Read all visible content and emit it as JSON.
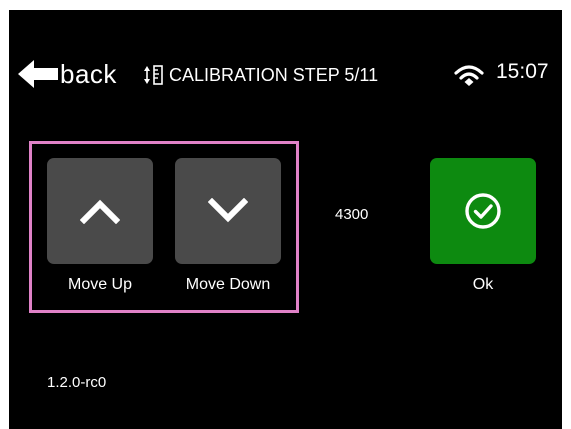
{
  "header": {
    "back_label": "back",
    "step_title": "CALIBRATION STEP 5/11",
    "time": "15:07"
  },
  "controls": {
    "move_up_label": "Move Up",
    "move_down_label": "Move Down",
    "ok_label": "Ok"
  },
  "readout": {
    "value": "4300"
  },
  "footer": {
    "version": "1.2.0-rc0"
  },
  "colors": {
    "background": "#000000",
    "tile_grey": "#4a4a4a",
    "ok_green": "#0d8a10",
    "selection_border": "#e082c8"
  },
  "icons": {
    "back": "left-arrow-icon",
    "step": "vertical-calibration-icon",
    "wifi": "wifi-icon",
    "up": "chevron-up-icon",
    "down": "chevron-down-icon",
    "ok": "check-circle-icon"
  }
}
